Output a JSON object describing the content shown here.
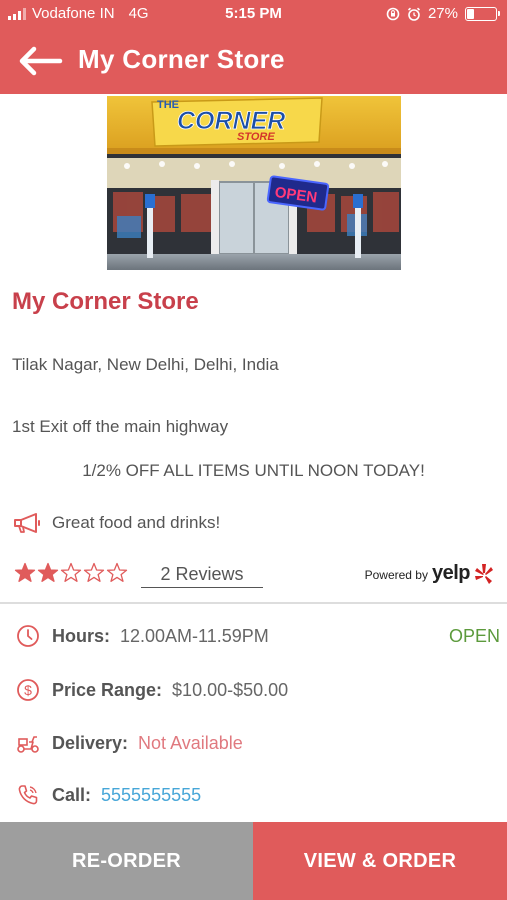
{
  "status_bar": {
    "carrier": "Vodafone IN",
    "network": "4G",
    "time": "5:15 PM",
    "battery_percent": "27%",
    "battery_level": 0.27
  },
  "app_bar": {
    "title": "My Corner Store",
    "back_icon": "arrow-left-icon"
  },
  "store_image": {
    "sign_top": "THE",
    "sign_main": "CORNER",
    "sign_sub": "STORE",
    "open_sign": "OPEN"
  },
  "store": {
    "name": "My Corner Store",
    "address": "Tilak Nagar, New Delhi, Delhi, India",
    "directions": "1st Exit off the main highway",
    "promo": "1/2% OFF ALL ITEMS UNTIL NOON TODAY!",
    "tagline": "Great food and drinks!",
    "rating": 2,
    "rating_max": 5,
    "reviews_label": "2 Reviews",
    "powered_by": "Powered by",
    "yelp": "yelp"
  },
  "info": {
    "hours_label": "Hours:",
    "hours_value": "12.00AM-11.59PM",
    "open_status": "OPEN",
    "price_label": "Price Range:",
    "price_value": "$10.00-$50.00",
    "delivery_label": "Delivery:",
    "delivery_value": "Not Available",
    "call_label": "Call:",
    "call_value": "5555555555"
  },
  "actions": {
    "reorder": "RE-ORDER",
    "view_order": "VIEW & ORDER"
  },
  "colors": {
    "accent": "#e05b5b",
    "title_red": "#c8404b",
    "open_green": "#5c9a3c",
    "link_blue": "#46a6d8",
    "reorder_grey": "#9e9e9e"
  }
}
